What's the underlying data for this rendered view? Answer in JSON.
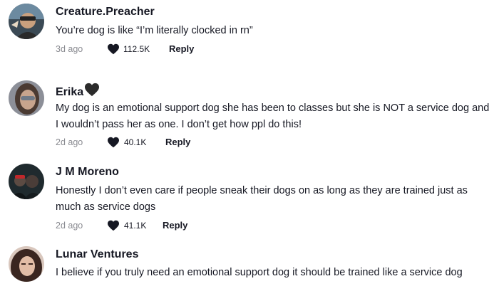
{
  "comments": [
    {
      "username": "Creature.Preacher",
      "text": "You’re dog is like “I’m literally clocked in rn”",
      "date": "3d ago",
      "likes": "112.5K",
      "reply_label": "Reply",
      "avatar_icon": "user-avatar-photo"
    },
    {
      "username": "Erika",
      "username_emoji": "black-heart-emoji",
      "text": "My dog is an emotional support dog she has been to classes but she is NOT a service dog and I wouldn’t pass her as one. I don’t get how ppl do this!",
      "date": "2d ago",
      "likes": "40.1K",
      "reply_label": "Reply",
      "avatar_icon": "user-avatar-photo"
    },
    {
      "username": "J M Moreno",
      "text": "Honestly I don’t even care if people sneak their dogs on as long as they are trained just as much as service dogs",
      "date": "2d ago",
      "likes": "41.1K",
      "reply_label": "Reply",
      "avatar_icon": "user-avatar-photo"
    },
    {
      "username": "Lunar Ventures",
      "text": "I believe if you truly need an emotional support dog it should be trained like a service dog",
      "avatar_icon": "user-avatar-photo"
    }
  ],
  "colors": {
    "text_primary": "#161823",
    "text_secondary": "#8a8b91",
    "heart": "#161823"
  }
}
